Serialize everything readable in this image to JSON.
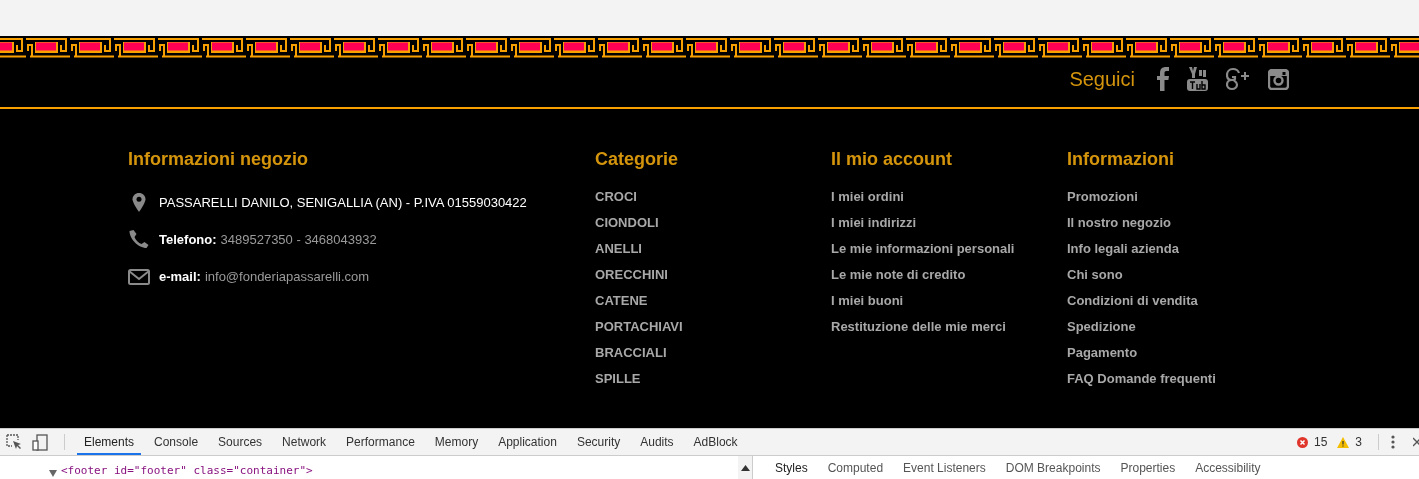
{
  "social": {
    "label": "Seguici",
    "icons": [
      {
        "kind": "facebook"
      },
      {
        "kind": "youtube"
      },
      {
        "kind": "googleplus"
      },
      {
        "kind": "instagram"
      }
    ]
  },
  "store_info": {
    "title": "Informazioni negozio",
    "items": [
      {
        "kind": "location",
        "value": "PASSARELLI DANILO, SENIGALLIA (AN) - P.IVA 01559030422"
      },
      {
        "kind": "phone",
        "label": "Telefono:",
        "value": "3489527350 - 3468043932"
      },
      {
        "kind": "email",
        "label": "e-mail:",
        "value": "info@fonderiapassarelli.com"
      }
    ]
  },
  "link_columns": [
    {
      "title": "Categorie",
      "items": [
        "CROCI",
        "CIONDOLI",
        "ANELLI",
        "ORECCHINI",
        "CATENE",
        "PORTACHIAVI",
        "BRACCIALI",
        "SPILLE"
      ]
    },
    {
      "title": "Il mio account",
      "items": [
        "I miei ordini",
        "I miei indirizzi",
        "Le mie informazioni personali",
        "Le mie note di credito",
        "I miei buoni",
        "Restituzione delle mie merci"
      ]
    },
    {
      "title": "Informazioni",
      "items": [
        "Promozioni",
        "Il nostro negozio",
        "Info legali azienda",
        "Chi sono",
        "Condizioni di vendita",
        "Spedizione",
        "Pagamento",
        "FAQ Domande frequenti"
      ]
    }
  ],
  "devtools": {
    "tabs": [
      {
        "label": "Elements",
        "selected": true
      },
      {
        "label": "Console",
        "selected": false
      },
      {
        "label": "Sources",
        "selected": false
      },
      {
        "label": "Network",
        "selected": false
      },
      {
        "label": "Performance",
        "selected": false
      },
      {
        "label": "Memory",
        "selected": false
      },
      {
        "label": "Application",
        "selected": false
      },
      {
        "label": "Security",
        "selected": false
      },
      {
        "label": "Audits",
        "selected": false
      },
      {
        "label": "AdBlock",
        "selected": false
      }
    ],
    "errors": "15",
    "warnings": "3",
    "code_line": {
      "text": "<footer id=\"footer\" class=\"container\">",
      "expanded": true
    },
    "side_tabs": [
      {
        "label": "Styles",
        "selected": true
      },
      {
        "label": "Computed",
        "selected": false
      },
      {
        "label": "Event Listeners",
        "selected": false
      },
      {
        "label": "DOM Breakpoints",
        "selected": false
      },
      {
        "label": "Properties",
        "selected": false
      },
      {
        "label": "Accessibility",
        "selected": false
      }
    ]
  }
}
